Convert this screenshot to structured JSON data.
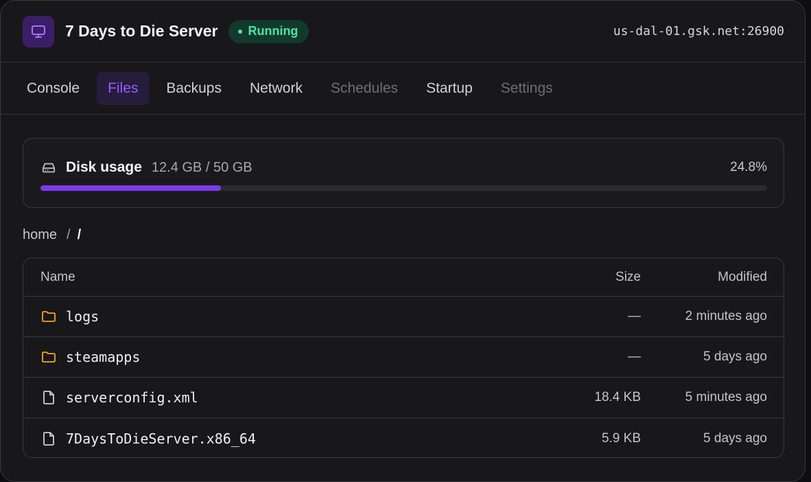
{
  "server": {
    "title": "7 Days to Die Server",
    "status": "Running",
    "address": "us-dal-01.gsk.net:26900"
  },
  "tabs": [
    {
      "label": "Console",
      "state": "normal"
    },
    {
      "label": "Files",
      "state": "active"
    },
    {
      "label": "Backups",
      "state": "normal"
    },
    {
      "label": "Network",
      "state": "normal"
    },
    {
      "label": "Schedules",
      "state": "disabled"
    },
    {
      "label": "Startup",
      "state": "normal"
    },
    {
      "label": "Settings",
      "state": "disabled"
    }
  ],
  "disk": {
    "label": "Disk usage",
    "amount": "12.4 GB / 50 GB",
    "percent_text": "24.8%",
    "fraction": 0.248
  },
  "breadcrumb": {
    "root": "home",
    "separator": "/",
    "current": "/"
  },
  "table": {
    "headers": {
      "name": "Name",
      "size": "Size",
      "modified": "Modified"
    },
    "rows": [
      {
        "type": "folder",
        "name": "logs",
        "size": "—",
        "modified": "2 minutes ago"
      },
      {
        "type": "folder",
        "name": "steamapps",
        "size": "—",
        "modified": "5 days ago"
      },
      {
        "type": "file",
        "name": "serverconfig.xml",
        "size": "18.4 KB",
        "modified": "5 minutes ago"
      },
      {
        "type": "file",
        "name": "7DaysToDieServer.x86_64",
        "size": "5.9 KB",
        "modified": "5 days ago"
      }
    ]
  },
  "colors": {
    "accent": "#7c3aed",
    "active_tab_text": "#9b5cff",
    "status_green": "#4fe0a8",
    "folder_icon": "#f5a623"
  },
  "icons": {
    "server": "monitor-icon",
    "disk": "hard-drive-icon",
    "folder": "folder-icon",
    "file": "file-icon"
  }
}
